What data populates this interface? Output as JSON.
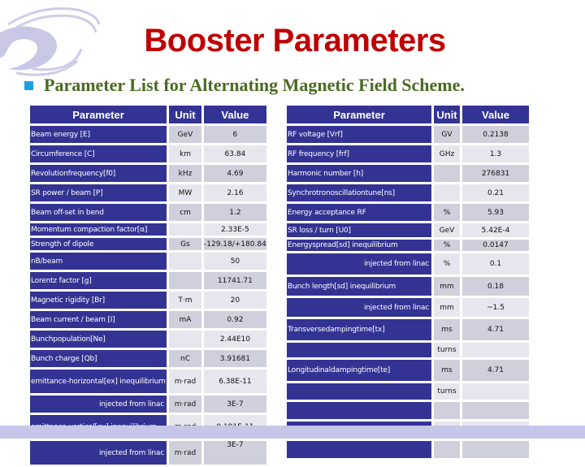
{
  "header": {
    "title": "Booster Parameters",
    "subtitle": "Parameter List for Alternating Magnetic Field Scheme.",
    "logo_icon": "ihep-logo-icon",
    "bullet_color": "#1ea0e0",
    "title_color": "#c00000",
    "subtitle_color": "#4a6a20"
  },
  "left_table": {
    "headers": [
      "Parameter",
      "Unit",
      "Value"
    ],
    "rows": [
      {
        "param": "Beam energy  [E]",
        "unit": "GeV",
        "value": "6"
      },
      {
        "param": "Circumference  [C]",
        "unit": "km",
        "value": "63.84"
      },
      {
        "param": "Revolutionfrequency[f0]",
        "unit": "kHz",
        "value": "4.69"
      },
      {
        "param": "SR power / beam [P]",
        "unit": "MW",
        "value": "2.16"
      },
      {
        "param": "Beam off-set in bend",
        "unit": "cm",
        "value": "1.2"
      },
      {
        "param": "Momentum compaction factor[α]",
        "unit": "",
        "value": "2.33E-5"
      },
      {
        "param": " Strength of dipole",
        "unit": "Gs",
        "value": "-129.18/+180.84"
      },
      {
        "param": "nB/beam",
        "unit": "",
        "value": "50"
      },
      {
        "param": "Lorentz factor [g]",
        "unit": "",
        "value": "11741.71"
      },
      {
        "param": "Magnetic rigidity [Br]",
        "unit": "T·m",
        "value": "20"
      },
      {
        "param": "Beam current / beam [I]",
        "unit": "mA",
        "value": "0.92"
      },
      {
        "param": "Bunchpopulation[Ne]",
        "unit": "",
        "value": "2.44E10"
      },
      {
        "param": "Bunch charge [Qb]",
        "unit": "nC",
        "value": "3.91681"
      },
      {
        "param": "emittance-horizontal[ex] inequilibrium",
        "unit": "m·rad",
        "value": "6.38E-11"
      },
      {
        "param": "injected from linac",
        "unit": "m·rad",
        "value": "3E-7"
      },
      {
        "param": "emittance-vertical[ey]  inequilibrium",
        "unit": "m·rad",
        "value": "0.191E-11"
      },
      {
        "param": "injected from linac",
        "unit": "m·rad",
        "value": "3E-7"
      }
    ]
  },
  "right_table": {
    "headers": [
      "Parameter",
      "Unit",
      "Value"
    ],
    "rows": [
      {
        "param": "RF voltage [Vrf]",
        "unit": "GV",
        "value": "0.2138"
      },
      {
        "param": "RF frequency [frf]",
        "unit": "GHz",
        "value": "1.3"
      },
      {
        "param": "Harmonic number [h]",
        "unit": "",
        "value": "276831"
      },
      {
        "param": "Synchrotronoscillationtune[ns]",
        "unit": "",
        "value": "0.21"
      },
      {
        "param": "Energy acceptance RF",
        "unit": "%",
        "value": "5.93"
      },
      {
        "param": "SR loss / turn  [U0]",
        "unit": "GeV",
        "value": "5.42E-4"
      },
      {
        "param": "Energyspread[sd]  inequilibrium",
        "unit": "%",
        "value": "0.0147"
      },
      {
        "param": "injected from linac",
        "unit": "%",
        "value": "0.1"
      },
      {
        "param": "Bunch length[sd]  inequilibrium",
        "unit": "mm",
        "value": "0.18"
      },
      {
        "param": "injected from linac",
        "unit": "mm",
        "value": "~1.5"
      },
      {
        "param": "Transversedampingtime[tx]",
        "unit": "ms",
        "value": "4.71"
      },
      {
        "param": "",
        "unit": "turns",
        "value": ""
      },
      {
        "param": "Longitudinaldampingtime[te]",
        "unit": "ms",
        "value": "4.71"
      },
      {
        "param": "",
        "unit": "turns",
        "value": ""
      },
      {
        "param": "",
        "unit": "",
        "value": ""
      },
      {
        "param": "",
        "unit": "",
        "value": ""
      },
      {
        "param": "",
        "unit": "",
        "value": ""
      }
    ]
  }
}
